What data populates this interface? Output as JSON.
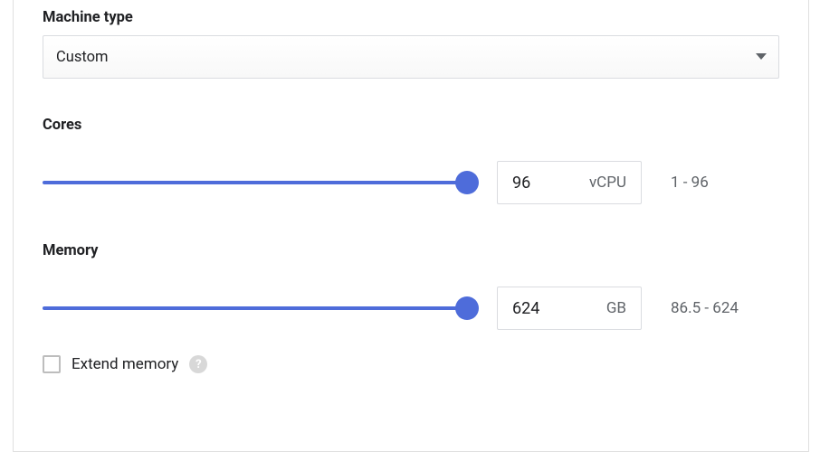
{
  "machine_type": {
    "label": "Machine type",
    "selected": "Custom"
  },
  "cores": {
    "label": "Cores",
    "value": "96",
    "unit": "vCPU",
    "range_text": "1 - 96",
    "min": 1,
    "max": 96
  },
  "memory": {
    "label": "Memory",
    "value": "624",
    "unit": "GB",
    "range_text": "86.5 - 624",
    "min": 86.5,
    "max": 624
  },
  "extend_memory": {
    "label": "Extend memory",
    "checked": false,
    "help_glyph": "?"
  }
}
